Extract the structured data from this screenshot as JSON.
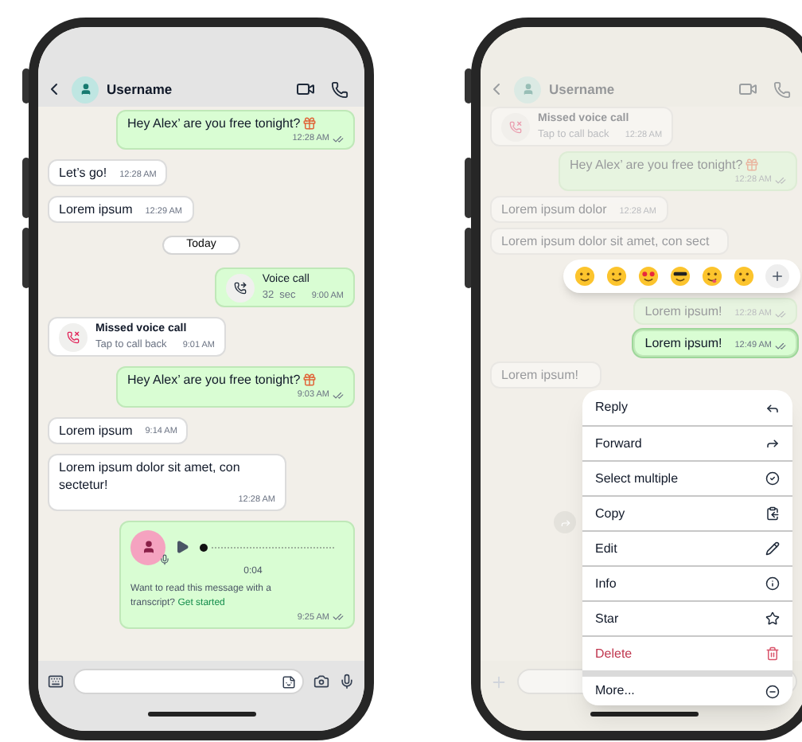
{
  "phones": [
    {
      "header": {
        "title": "Username"
      },
      "composer": {
        "kind": "keyboard"
      },
      "messages": [
        {
          "kind": "text",
          "outgoing": true,
          "text": "Hey Alex’ are you free tonight?",
          "gift": true,
          "time": "12:28 AM",
          "read": true
        },
        {
          "kind": "text",
          "outgoing": false,
          "text": "Let’s go!",
          "time": "12:28 AM"
        },
        {
          "kind": "text",
          "outgoing": false,
          "text": "Lorem ipsum",
          "time": "12:29 AM"
        },
        {
          "kind": "date",
          "text": "Today"
        },
        {
          "kind": "call",
          "outgoing": true,
          "title": "Voice call",
          "detail": "32  sec",
          "time": "9:00 AM"
        },
        {
          "kind": "missed_call",
          "outgoing": false,
          "title": "Missed voice call",
          "detail": "Tap to call back",
          "time": "9:01 AM"
        },
        {
          "kind": "text",
          "outgoing": true,
          "text": "Hey Alex’ are you free tonight?",
          "gift": true,
          "time": "9:03 AM",
          "read": true
        },
        {
          "kind": "text",
          "outgoing": false,
          "text": "Lorem ipsum",
          "time": "9:14 AM"
        },
        {
          "kind": "text",
          "outgoing": false,
          "text": "Lorem ipsum dolor sit amet, con sectetur!",
          "time": "12:28 AM"
        },
        {
          "kind": "voice_note",
          "outgoing": true,
          "duration": "0:04",
          "prompt": "Want to read this message with a transcript?",
          "link": "Get started",
          "time": "9:25 AM",
          "read": true
        }
      ]
    },
    {
      "header": {
        "title": "Username"
      },
      "composer": {
        "kind": "plus"
      },
      "messages": [
        {
          "kind": "missed_call",
          "outgoing": false,
          "title": "Missed voice call",
          "detail": "Tap to call back",
          "time": "12:28 AM",
          "selected": false
        },
        {
          "kind": "text",
          "outgoing": true,
          "text": "Hey Alex’ are you free tonight?",
          "gift": true,
          "time": "12:28 AM",
          "read": true,
          "selected": false
        },
        {
          "kind": "text",
          "outgoing": false,
          "text": "Lorem ipsum dolor",
          "time": "12:28 AM",
          "selected": false
        },
        {
          "kind": "text",
          "outgoing": false,
          "text": "Lorem ipsum dolor sit amet, con sect",
          "selected": false
        },
        {
          "kind": "reactions"
        },
        {
          "kind": "text",
          "outgoing": true,
          "text": "Lorem ipsum!",
          "time": "12:28 AM",
          "read": true,
          "selected": false
        },
        {
          "kind": "text",
          "outgoing": true,
          "text": "Lorem ipsum!",
          "time": "12:49 AM",
          "read": true,
          "selected": true
        },
        {
          "kind": "text",
          "outgoing": false,
          "text": "Lorem ipsum!",
          "selected": false
        }
      ],
      "menu": [
        {
          "kind": "reply",
          "label": "Reply"
        },
        {
          "kind": "forward",
          "label": "Forward"
        },
        {
          "kind": "select",
          "label": "Select multiple"
        },
        {
          "kind": "copy",
          "label": "Copy"
        },
        {
          "kind": "edit",
          "label": "Edit"
        },
        {
          "kind": "info",
          "label": "Info"
        },
        {
          "kind": "star",
          "label": "Star"
        },
        {
          "kind": "delete",
          "label": "Delete"
        },
        {
          "kind": "more",
          "label": "More..."
        }
      ]
    }
  ]
}
